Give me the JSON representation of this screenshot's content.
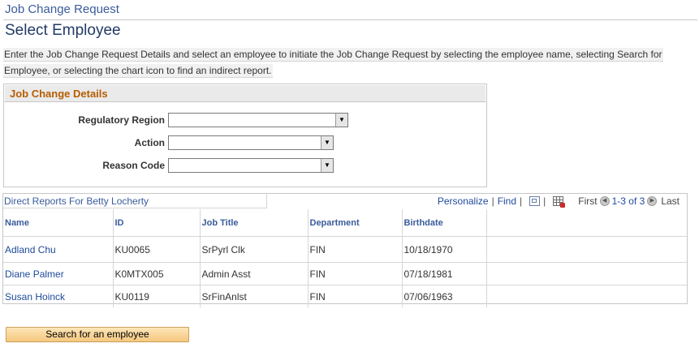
{
  "breadcrumb": "Job Change Request",
  "page_title": "Select Employee",
  "instructions": {
    "line1": "Enter the Job Change Request Details and select an employee to initiate the Job Change Request by selecting the employee name, selecting Search for",
    "line2": "Employee, or selecting the chart icon to find an indirect report."
  },
  "details": {
    "title": "Job Change Details",
    "fields": [
      {
        "label": "Regulatory Region",
        "value": ""
      },
      {
        "label": "Action",
        "value": ""
      },
      {
        "label": "Reason Code",
        "value": ""
      }
    ]
  },
  "grid": {
    "caption": "Direct Reports For Betty Locherty",
    "nav": {
      "personalize": "Personalize",
      "separator": "|",
      "find": "Find",
      "first": "First",
      "range": "1-3 of 3",
      "last": "Last"
    },
    "columns": [
      "Name",
      "ID",
      "Job Title",
      "Department",
      "Birthdate"
    ],
    "rows": [
      {
        "name": "Adland Chu",
        "id": "KU0065",
        "job_title": "SrPyrl Clk",
        "department": "FIN",
        "birthdate": "10/18/1970"
      },
      {
        "name": "Diane Palmer",
        "id": "K0MTX005",
        "job_title": "Admin Asst",
        "department": "FIN",
        "birthdate": "07/18/1981"
      },
      {
        "name": "Susan Hoinck",
        "id": "KU0119",
        "job_title": "SrFinAnlst",
        "department": "FIN",
        "birthdate": "07/06/1963"
      }
    ]
  },
  "search_button": "Search for an employee",
  "colors": {
    "link": "#1d4a9c",
    "group_title": "#b75d00",
    "button": "#f5c77e"
  },
  "icons": [
    "dropdown-arrow-icon",
    "zoom-view-icon",
    "download-grid-icon",
    "previous-arrow-icon",
    "next-arrow-icon"
  ]
}
